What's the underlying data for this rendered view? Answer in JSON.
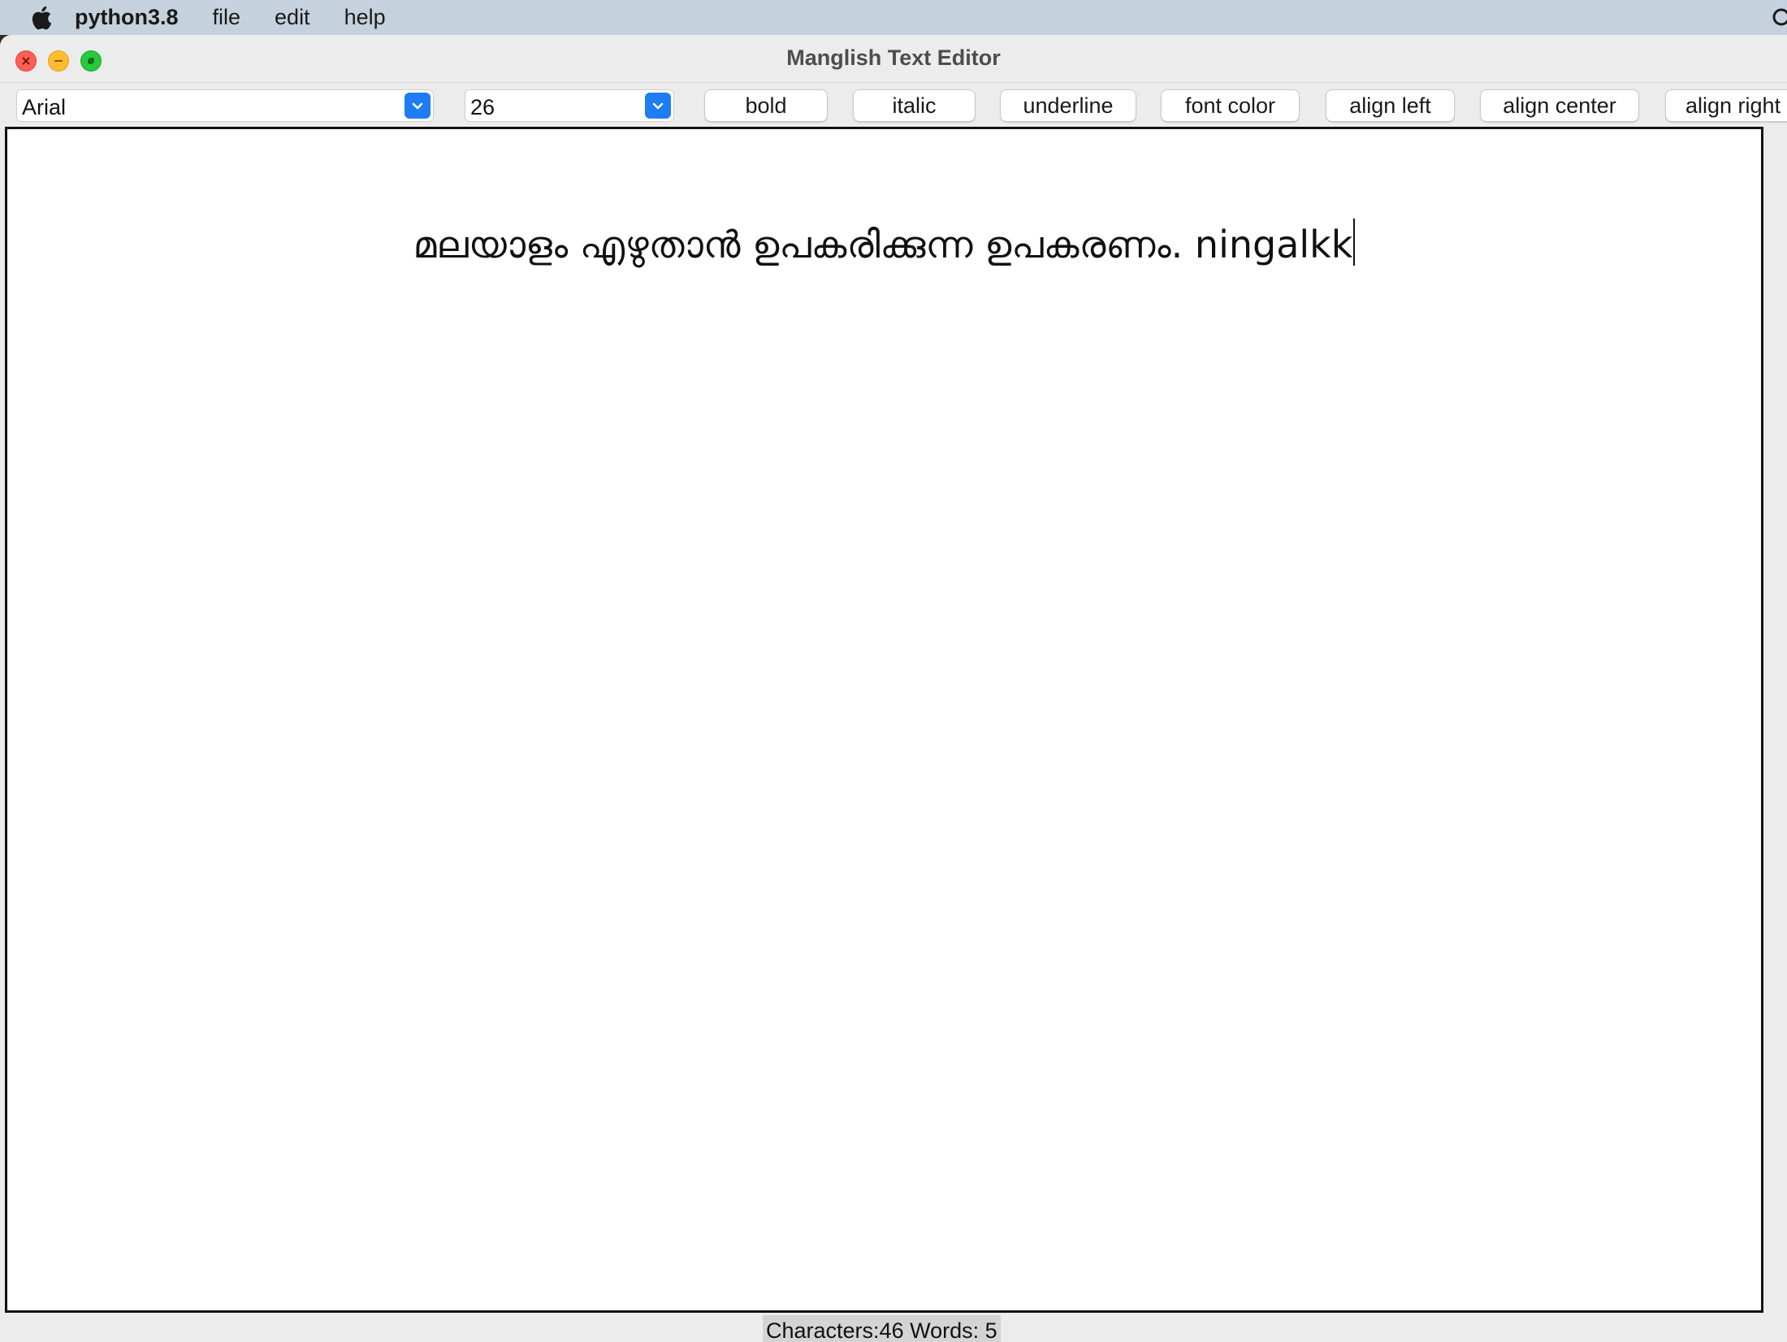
{
  "menubar": {
    "app_name": "python3.8",
    "items": [
      {
        "label": "file"
      },
      {
        "label": "edit"
      },
      {
        "label": "help"
      }
    ]
  },
  "window": {
    "title": "Manglish Text Editor"
  },
  "toolbar": {
    "font_family_value": "Arial",
    "font_size_value": "26",
    "buttons": {
      "bold": "bold",
      "italic": "italic",
      "underline": "underline",
      "font_color": "font color",
      "align_left": "align left",
      "align_center": "align center",
      "align_right": "align right"
    }
  },
  "editor": {
    "content": "മലയാളം എഴുതാൻ ഉപകരിക്കുന്ന ഉപകരണം. ningalkk",
    "alignment": "center"
  },
  "statusbar": {
    "text": "Characters:46 Words: 5"
  },
  "colors": {
    "menubar_bg": "#c5d2de",
    "combo_accent": "#1e7cf5",
    "close": "#ff5f57",
    "minimize": "#febc2e",
    "maximize": "#28c840"
  },
  "icons": [
    "apple-logo-icon",
    "control-center-icon",
    "close-icon",
    "minimize-icon",
    "zoom-icon",
    "chevron-down-icon"
  ]
}
